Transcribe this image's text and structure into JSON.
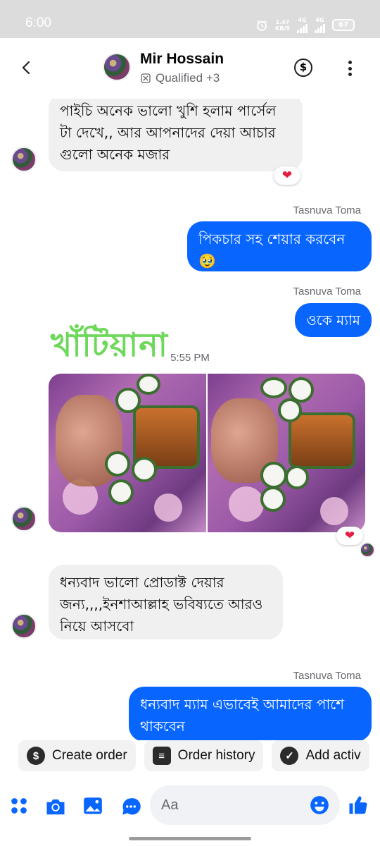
{
  "status": {
    "time": "6:00",
    "net_speed": "1.47",
    "net_unit": "KB/S",
    "net1": "4G",
    "net2": "4G",
    "battery": "67"
  },
  "header": {
    "name": "Mir Hossain",
    "subtitle": "Qualified +3"
  },
  "messages": {
    "m1": "পাইচি অনেক ভালো খুশি হলাম পার্সেল টা দেখে,, আর আপনাদের দেয়া আচার গুলো অনেক মজার",
    "s1": "Tasnuva Toma",
    "o1_line1": "পিকচার সহ শেয়ার করবেন",
    "o1_emoji": "🥹",
    "s2": "Tasnuva Toma",
    "o2": "ওকে ম্যাম",
    "timestamp": "5:55 PM",
    "brand_watermark": "খাঁটিয়ানা",
    "m3": "ধন্যবাদ ভালো প্রোডাক্ট দেয়ার জন্য,,,,ইনশাআল্লাহ ভবিষ্যতে আরও নিয়ে আসবো",
    "s3": "Tasnuva Toma",
    "o3": "ধন্যবাদ ম্যাম এভাবেই আমাদের পাশে থাকবেন"
  },
  "quick_actions": [
    {
      "label": "Create order",
      "icon": "dollar-icon"
    },
    {
      "label": "Order history",
      "icon": "list-icon"
    },
    {
      "label": "Add activ",
      "icon": "check-circle-icon"
    }
  ],
  "composer": {
    "placeholder": "Aa"
  },
  "colors": {
    "accent": "#0866ff",
    "in_bubble": "#f0f0f0",
    "heart": "#e41e3f"
  }
}
